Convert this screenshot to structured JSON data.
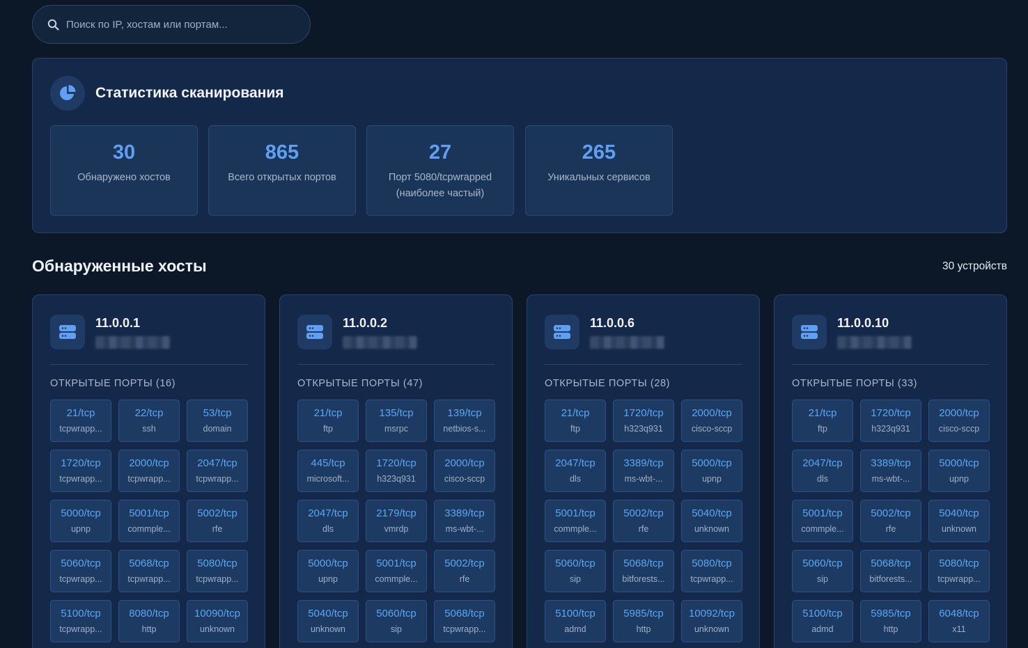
{
  "search": {
    "placeholder": "Поиск по IP, хостам или портам..."
  },
  "stats": {
    "title": "Статистика сканирования",
    "cards": [
      {
        "value": "30",
        "label": "Обнаружено хостов"
      },
      {
        "value": "865",
        "label": "Всего открытых портов"
      },
      {
        "value": "27",
        "label": "Порт 5080/tcpwrapped (наиболее частый)"
      },
      {
        "value": "265",
        "label": "Уникальных сервисов"
      }
    ]
  },
  "hosts_section": {
    "title": "Обнаруженные хосты",
    "count": "30 устройств"
  },
  "hosts": [
    {
      "ip": "11.0.0.1",
      "ports_title": "ОТКРЫТЫЕ ПОРТЫ (16)",
      "ports": [
        {
          "port": "21/tcp",
          "service": "tcpwrapp..."
        },
        {
          "port": "22/tcp",
          "service": "ssh"
        },
        {
          "port": "53/tcp",
          "service": "domain"
        },
        {
          "port": "1720/tcp",
          "service": "tcpwrapp..."
        },
        {
          "port": "2000/tcp",
          "service": "tcpwrapp..."
        },
        {
          "port": "2047/tcp",
          "service": "tcpwrapp..."
        },
        {
          "port": "5000/tcp",
          "service": "upnp"
        },
        {
          "port": "5001/tcp",
          "service": "commple..."
        },
        {
          "port": "5002/tcp",
          "service": "rfe"
        },
        {
          "port": "5060/tcp",
          "service": "tcpwrapp..."
        },
        {
          "port": "5068/tcp",
          "service": "tcpwrapp..."
        },
        {
          "port": "5080/tcp",
          "service": "tcpwrapp..."
        },
        {
          "port": "5100/tcp",
          "service": "tcpwrapp..."
        },
        {
          "port": "8080/tcp",
          "service": "http"
        },
        {
          "port": "10090/tcp",
          "service": "unknown"
        }
      ]
    },
    {
      "ip": "11.0.0.2",
      "ports_title": "ОТКРЫТЫЕ ПОРТЫ (47)",
      "ports": [
        {
          "port": "21/tcp",
          "service": "ftp"
        },
        {
          "port": "135/tcp",
          "service": "msrpc"
        },
        {
          "port": "139/tcp",
          "service": "netbios-s..."
        },
        {
          "port": "445/tcp",
          "service": "microsoft..."
        },
        {
          "port": "1720/tcp",
          "service": "h323q931"
        },
        {
          "port": "2000/tcp",
          "service": "cisco-sccp"
        },
        {
          "port": "2047/tcp",
          "service": "dls"
        },
        {
          "port": "2179/tcp",
          "service": "vmrdp"
        },
        {
          "port": "3389/tcp",
          "service": "ms-wbt-..."
        },
        {
          "port": "5000/tcp",
          "service": "upnp"
        },
        {
          "port": "5001/tcp",
          "service": "commple..."
        },
        {
          "port": "5002/tcp",
          "service": "rfe"
        },
        {
          "port": "5040/tcp",
          "service": "unknown"
        },
        {
          "port": "5060/tcp",
          "service": "sip"
        },
        {
          "port": "5068/tcp",
          "service": "tcpwrapp..."
        }
      ]
    },
    {
      "ip": "11.0.0.6",
      "ports_title": "ОТКРЫТЫЕ ПОРТЫ (28)",
      "ports": [
        {
          "port": "21/tcp",
          "service": "ftp"
        },
        {
          "port": "1720/tcp",
          "service": "h323q931"
        },
        {
          "port": "2000/tcp",
          "service": "cisco-sccp"
        },
        {
          "port": "2047/tcp",
          "service": "dls"
        },
        {
          "port": "3389/tcp",
          "service": "ms-wbt-..."
        },
        {
          "port": "5000/tcp",
          "service": "upnp"
        },
        {
          "port": "5001/tcp",
          "service": "commple..."
        },
        {
          "port": "5002/tcp",
          "service": "rfe"
        },
        {
          "port": "5040/tcp",
          "service": "unknown"
        },
        {
          "port": "5060/tcp",
          "service": "sip"
        },
        {
          "port": "5068/tcp",
          "service": "bitforests..."
        },
        {
          "port": "5080/tcp",
          "service": "tcpwrapp..."
        },
        {
          "port": "5100/tcp",
          "service": "admd"
        },
        {
          "port": "5985/tcp",
          "service": "http"
        },
        {
          "port": "10092/tcp",
          "service": "unknown"
        }
      ]
    },
    {
      "ip": "11.0.0.10",
      "ports_title": "ОТКРЫТЫЕ ПОРТЫ (33)",
      "ports": [
        {
          "port": "21/tcp",
          "service": "ftp"
        },
        {
          "port": "1720/tcp",
          "service": "h323q931"
        },
        {
          "port": "2000/tcp",
          "service": "cisco-sccp"
        },
        {
          "port": "2047/tcp",
          "service": "dls"
        },
        {
          "port": "3389/tcp",
          "service": "ms-wbt-..."
        },
        {
          "port": "5000/tcp",
          "service": "upnp"
        },
        {
          "port": "5001/tcp",
          "service": "commple..."
        },
        {
          "port": "5002/tcp",
          "service": "rfe"
        },
        {
          "port": "5040/tcp",
          "service": "unknown"
        },
        {
          "port": "5060/tcp",
          "service": "sip"
        },
        {
          "port": "5068/tcp",
          "service": "bitforests..."
        },
        {
          "port": "5080/tcp",
          "service": "tcpwrapp..."
        },
        {
          "port": "5100/tcp",
          "service": "admd"
        },
        {
          "port": "5985/tcp",
          "service": "http"
        },
        {
          "port": "6048/tcp",
          "service": "x11"
        }
      ]
    }
  ],
  "colors": {
    "accent": "#5fa0f5",
    "port_text": "#5aa7f2",
    "background": "#0c1728",
    "panel": "#14294a"
  },
  "icons": {
    "search": "search-icon",
    "stats": "pie-chart-icon",
    "host": "server-icon"
  }
}
